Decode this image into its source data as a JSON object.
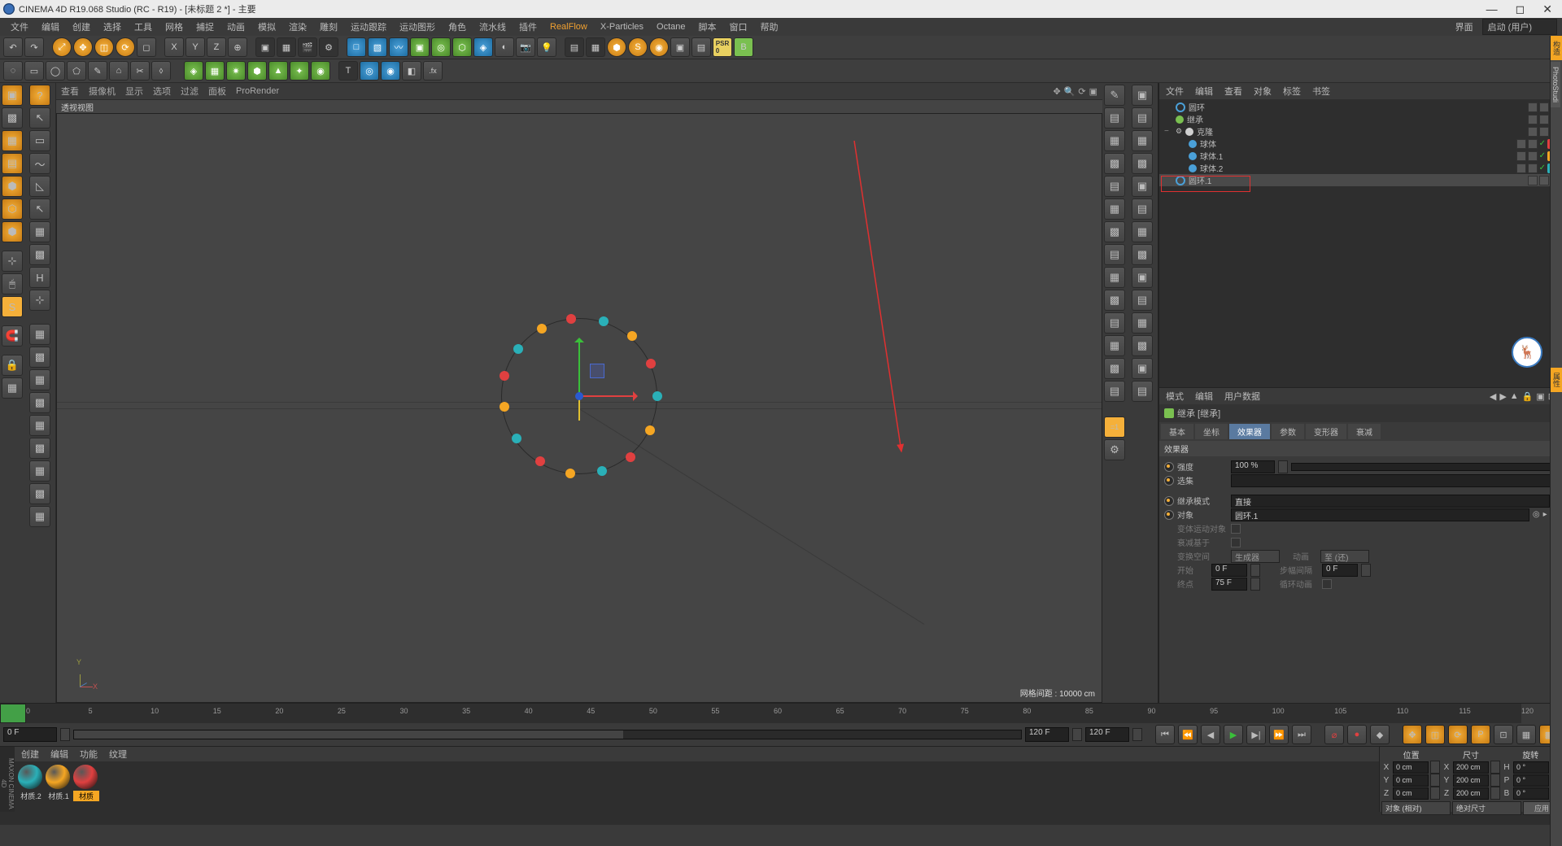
{
  "title": "CINEMA 4D R19.068 Studio (RC - R19) - [未标题 2 *] - 主要",
  "menu": [
    "文件",
    "编辑",
    "创建",
    "选择",
    "工具",
    "网格",
    "捕捉",
    "动画",
    "模拟",
    "渲染",
    "雕刻",
    "运动跟踪",
    "运动图形",
    "角色",
    "流水线",
    "插件",
    "RealFlow",
    "X-Particles",
    "Octane",
    "脚本",
    "窗口",
    "帮助"
  ],
  "layout_label": "界面",
  "layout_value": "启动 (用户)",
  "viewport_menu": [
    "查看",
    "摄像机",
    "显示",
    "选项",
    "过滤",
    "面板",
    "ProRender"
  ],
  "viewport_title": "透视视图",
  "grid_label": "网格间距 : 10000 cm",
  "timeline_ticks": [
    "0",
    "5",
    "10",
    "15",
    "20",
    "25",
    "30",
    "35",
    "40",
    "45",
    "50",
    "55",
    "60",
    "65",
    "70",
    "75",
    "80",
    "85",
    "90",
    "95",
    "100",
    "105",
    "110",
    "115",
    "120"
  ],
  "time_start": "0 F",
  "time_cur": "0 F",
  "time_end": "120 F",
  "time_end2": "120 F",
  "gizmo_labels": {
    "y": "Y",
    "x": "X"
  },
  "mat_menu": [
    "创建",
    "编辑",
    "功能",
    "纹理"
  ],
  "materials": [
    {
      "name": "材质.2",
      "color": "#2ab0b8"
    },
    {
      "name": "材质.1",
      "color": "#f5a623"
    },
    {
      "name": "材质",
      "color": "#e04040"
    }
  ],
  "coord": {
    "headers": [
      "位置",
      "尺寸",
      "旋转"
    ],
    "axes": [
      "X",
      "Y",
      "Z"
    ],
    "pos": [
      "0 cm",
      "0 cm",
      "0 cm"
    ],
    "size": [
      "200 cm",
      "200 cm",
      "200 cm"
    ],
    "rot": [
      "0 °",
      "0 °",
      "0 °"
    ],
    "mode1": "对象 (相对)",
    "mode2": "绝对尺寸",
    "apply": "应用"
  },
  "obj_menu": [
    "文件",
    "编辑",
    "查看",
    "对象",
    "标签",
    "书签"
  ],
  "obj_tree": [
    {
      "indent": 0,
      "icon": "#4aa0d8",
      "type": "ring",
      "name": "圆环",
      "toggle": ""
    },
    {
      "indent": 0,
      "icon": "#7ac050",
      "type": "eff",
      "name": "继承",
      "toggle": ""
    },
    {
      "indent": 0,
      "icon": "#d0d0d0",
      "type": "cloner",
      "name": "克隆",
      "toggle": "−",
      "gear": true
    },
    {
      "indent": 1,
      "icon": "#4aa0d8",
      "type": "sphere",
      "name": "球体",
      "toggle": "",
      "tag": "#e04040"
    },
    {
      "indent": 1,
      "icon": "#4aa0d8",
      "type": "sphere",
      "name": "球体.1",
      "toggle": "",
      "tag": "#f5a623"
    },
    {
      "indent": 1,
      "icon": "#4aa0d8",
      "type": "sphere",
      "name": "球体.2",
      "toggle": "",
      "tag": "#2ab0b8"
    },
    {
      "indent": 0,
      "icon": "#4aa0d8",
      "type": "ring",
      "name": "圆环.1",
      "toggle": "",
      "sel": true
    }
  ],
  "attr_menu": [
    "模式",
    "编辑",
    "用户数据"
  ],
  "attr_title_icon": "继承",
  "attr_title": "继承 [继承]",
  "attr_tabs": [
    "基本",
    "坐标",
    "效果器",
    "参数",
    "变形器",
    "衰减"
  ],
  "attr_tab_active": 2,
  "attr_section": "效果器",
  "attr": {
    "strength_l": "强度",
    "strength_v": "100 %",
    "sel_l": "选集",
    "mode_l": "继承模式",
    "mode_v": "直接",
    "obj_l": "对象",
    "obj_v": "圆环.1",
    "morph_l": "变体运动对象",
    "falloff_l": "衰减基于",
    "space_l": "变换空间",
    "space_v1": "生成器",
    "anim_l": "动画",
    "anim_v": "至 (还)",
    "start_l": "开始",
    "start_v": "0 F",
    "step_l": "步幅间隔",
    "step_v": "0 F",
    "end_l": "终点",
    "end_v": "75 F",
    "loop_l": "循环动画"
  }
}
